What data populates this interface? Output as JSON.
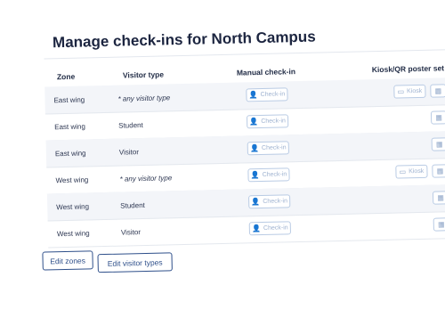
{
  "title": "Manage check-ins for North Campus",
  "columns": {
    "zone": "Zone",
    "visitor_type": "Visitor type",
    "manual": "Manual check-in",
    "kiosk": "Kiosk/QR poster set"
  },
  "rows": [
    {
      "zone": "East wing",
      "visitor": "* any visitor type",
      "checkin": "Check-in",
      "kiosk": "Kiosk",
      "has_kiosk": true
    },
    {
      "zone": "East wing",
      "visitor": "Student",
      "checkin": "Check-in",
      "kiosk": "",
      "has_kiosk": false
    },
    {
      "zone": "East wing",
      "visitor": "Visitor",
      "checkin": "Check-in",
      "kiosk": "",
      "has_kiosk": false
    },
    {
      "zone": "West wing",
      "visitor": "* any visitor type",
      "checkin": "Check-in",
      "kiosk": "Kiosk",
      "has_kiosk": true
    },
    {
      "zone": "West wing",
      "visitor": "Student",
      "checkin": "Check-in",
      "kiosk": "",
      "has_kiosk": false
    },
    {
      "zone": "West wing",
      "visitor": "Visitor",
      "checkin": "Check-in",
      "kiosk": "",
      "has_kiosk": false
    }
  ],
  "icons": {
    "checkin": "user-check-icon",
    "kiosk": "tablet-icon",
    "qr": "qr-grid-icon"
  },
  "actions": {
    "edit_zones": "Edit zones",
    "edit_visitor_types": "Edit visitor types"
  },
  "colors": {
    "primary": "#2e4f8a",
    "button_outline": "#b9cbe4",
    "shaded_row": "#f3f5f9"
  }
}
